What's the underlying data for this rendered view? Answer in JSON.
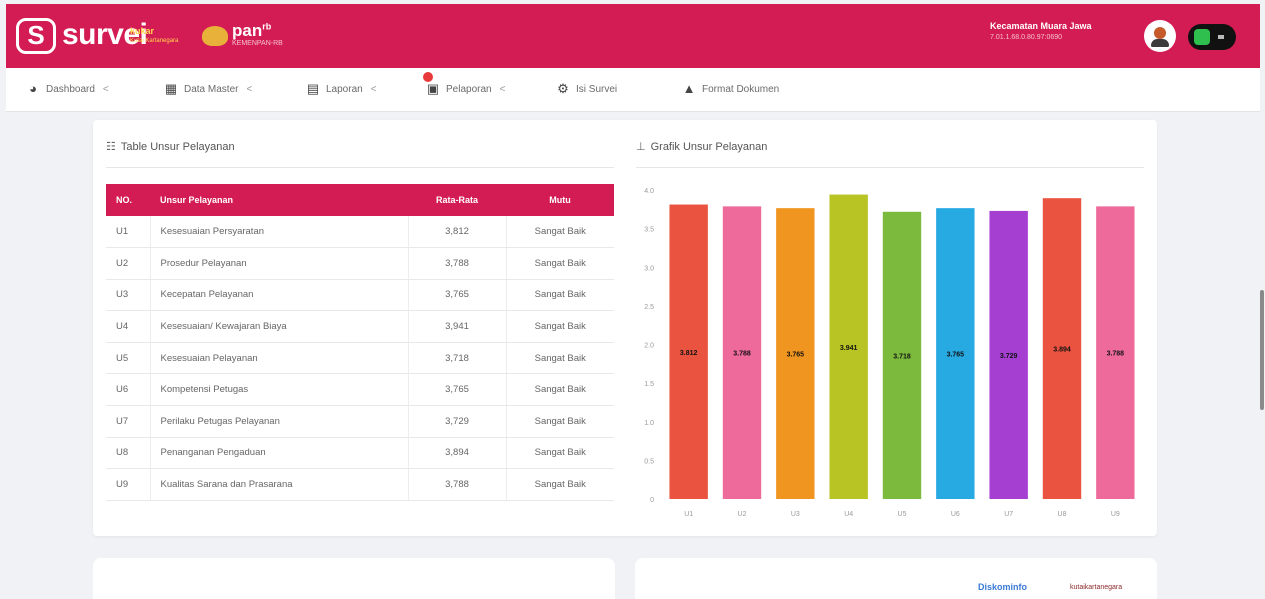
{
  "header": {
    "brand": "survei",
    "brand_sub": "kukar",
    "brand_sub2": "Kutai Kartanegara",
    "partner": "pan",
    "partner_sup": "rb",
    "partner_sub": "KEMENPAN-RB",
    "user_name": "Kecamatan Muara Jawa",
    "user_ip": "7.01.1.68.0.80.97:0690",
    "colors": {
      "primary": "#d41c54",
      "toggle": "#111111",
      "toggle_on": "#2fbf4f"
    }
  },
  "nav": {
    "items": [
      {
        "label": "Dashboard",
        "icon": "dashboard-icon",
        "has_chevron": true
      },
      {
        "label": "Data Master",
        "icon": "grid-icon",
        "has_chevron": true
      },
      {
        "label": "Laporan",
        "icon": "document-icon",
        "has_chevron": true
      },
      {
        "label": "Pelaporan",
        "icon": "report-icon",
        "has_chevron": true
      },
      {
        "label": "Isi Survei",
        "icon": "survey-icon",
        "has_chevron": false
      },
      {
        "label": "Format Dokumen",
        "icon": "drive-icon",
        "has_chevron": false
      }
    ],
    "chevron": "<"
  },
  "table_section": {
    "title": "Table Unsur Pelayanan",
    "icon": "table-icon",
    "headers": [
      "NO.",
      "Unsur Pelayanan",
      "Rata-Rata",
      "Mutu"
    ],
    "rows": [
      [
        "U1",
        "Kesesuaian Persyaratan",
        "3,812",
        "Sangat Baik"
      ],
      [
        "U2",
        "Prosedur Pelayanan",
        "3,788",
        "Sangat Baik"
      ],
      [
        "U3",
        "Kecepatan Pelayanan",
        "3,765",
        "Sangat Baik"
      ],
      [
        "U4",
        "Kesesuaian/ Kewajaran Biaya",
        "3,941",
        "Sangat Baik"
      ],
      [
        "U5",
        "Kesesuaian Pelayanan",
        "3,718",
        "Sangat Baik"
      ],
      [
        "U6",
        "Kompetensi Petugas",
        "3,765",
        "Sangat Baik"
      ],
      [
        "U7",
        "Perilaku Petugas Pelayanan",
        "3,729",
        "Sangat Baik"
      ],
      [
        "U8",
        "Penanganan Pengaduan",
        "3,894",
        "Sangat Baik"
      ],
      [
        "U9",
        "Kualitas Sarana dan Prasarana",
        "3,788",
        "Sangat Baik"
      ]
    ]
  },
  "chart_section": {
    "title": "Grafik Unsur Pelayanan",
    "icon": "chart-icon"
  },
  "chart_data": {
    "type": "bar",
    "categories": [
      "U1",
      "U2",
      "U3",
      "U4",
      "U5",
      "U6",
      "U7",
      "U8",
      "U9"
    ],
    "values": [
      3.812,
      3.788,
      3.765,
      3.941,
      3.718,
      3.765,
      3.729,
      3.894,
      3.788
    ],
    "value_labels": [
      "3.812",
      "3.788",
      "3.765",
      "3.941",
      "3.718",
      "3.765",
      "3.729",
      "3.894",
      "3.788"
    ],
    "colors": [
      "#e9533f",
      "#ee6a9a",
      "#f0951f",
      "#b8c424",
      "#7cba3e",
      "#27a9e1",
      "#a43fd1",
      "#e9533f",
      "#ee6a9a"
    ],
    "yticks": [
      "0",
      "0.5",
      "1.0",
      "1.5",
      "2.0",
      "2.5",
      "3.0",
      "3.5",
      "4.0"
    ],
    "ylim": [
      0,
      4
    ],
    "grid": false,
    "title": "",
    "xlabel": "",
    "ylabel": ""
  },
  "footer": {
    "logo1": "Diskominfo",
    "logo2": "kutaikartanegara"
  }
}
